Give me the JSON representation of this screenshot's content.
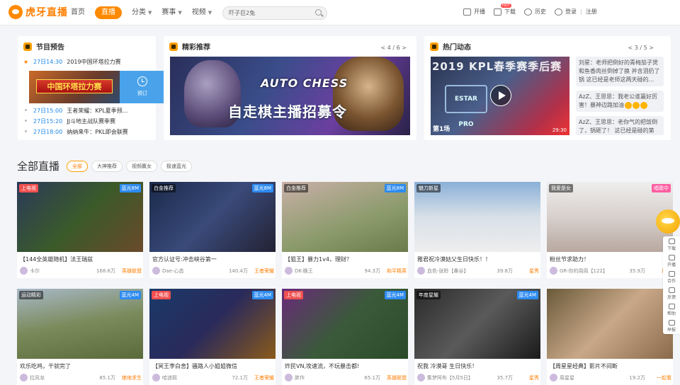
{
  "brand": {
    "name": "虎牙直播"
  },
  "nav": {
    "items": [
      {
        "label": "首页"
      },
      {
        "label": "直播"
      },
      {
        "label": "分类"
      },
      {
        "label": "赛事"
      },
      {
        "label": "视频"
      }
    ]
  },
  "search": {
    "value": "吓子巨2兔"
  },
  "tools": {
    "live": "开播",
    "download": "下载",
    "download_badge": "HOT",
    "history": "历史",
    "login": "登录",
    "sep": "|",
    "register": "注册"
  },
  "schedule": {
    "title": "节目预告",
    "featured_banner": "中国环塔拉力赛",
    "book": "预订",
    "rows": [
      {
        "time": "27日14:30",
        "title": "2019中国环塔拉力赛"
      },
      {
        "time": "27日15:00",
        "title": "王者荣耀：KPL夏季预..."
      },
      {
        "time": "27日15:20",
        "title": "JJ斗地主战队赛季赛"
      },
      {
        "time": "27日18:00",
        "title": "纳纳来牛：PKL即会联赛"
      }
    ]
  },
  "featured": {
    "title": "精彩推荐",
    "pager": "< 4 / 6 >",
    "logo": "AUTO CHESS",
    "headline": "自走棋主播招募令"
  },
  "hot": {
    "title": "热门动态",
    "pager": "< 3 / 5 >",
    "video_title": "2019 KPL春季赛季后赛",
    "team": "ESTAR PRO",
    "round": "第1场",
    "duration": "29:30",
    "comments": [
      {
        "text": "刘星：老师把倒好的青梅茄子煲和鱼香肉丝倒掉了换 并含泪扔了锅 这已经是老师这两天碰的..."
      },
      {
        "text": "AzZ、王思思：我老公谁赢好厉害！暴神边路加油"
      },
      {
        "text": "AzZ、王思思：老你气的把饭倒了，锅砸了！ 这已经是碰的第"
      }
    ]
  },
  "section": {
    "title": "全部直播",
    "chips": [
      "全部",
      "大神推荐",
      "视频赢女",
      "极速蓝光"
    ]
  },
  "cards": [
    {
      "tag": "上电视",
      "quality": "蓝光8M",
      "title": "【144全英雄随机】法王瑞兹",
      "user": "卡尔",
      "views": "168.6万",
      "cat": "英雄联盟"
    },
    {
      "tag": "白金推荐",
      "quality": "蓝光8M",
      "title": "官方认证号:冲击峡谷第一",
      "user": "Dae-心态",
      "views": "140.4万",
      "cat": "王者荣耀"
    },
    {
      "tag": "白金推荐",
      "quality": "蓝光8M",
      "title": "【狙王】暴力1v4，理财？",
      "user": "DK-晚王",
      "views": "94.3万",
      "cat": "和平精英"
    },
    {
      "tag": "魅力新星",
      "quality": "",
      "title": "雅君祝冷漠姑父生日快乐！！",
      "user": "血色-张聆【桑谷】",
      "views": "39.8万",
      "cat": "星秀"
    },
    {
      "tag": "我爱是女",
      "quality": "唱歌中",
      "title": "粉丝节求助力！",
      "user": "GR-你的周周【122】",
      "views": "35.9万",
      "cat": "星秀"
    },
    {
      "tag": "运动精彩",
      "quality": "蓝光4M",
      "title": "欢乐吃鸡，干就完了",
      "user": "拉风龙",
      "views": "85.1万",
      "cat": "绝地求生"
    },
    {
      "tag": "上电视",
      "quality": "蓝光4M",
      "title": "【冥王李白舍】骚路人小姐姐微信",
      "user": "哈迷熙",
      "views": "72.1万",
      "cat": "王者荣耀"
    },
    {
      "tag": "上电视",
      "quality": "蓝光4M",
      "title": "炸民VN,攻速流，不玩暴击都!",
      "user": "胖作",
      "views": "65.1万",
      "cat": "英雄联盟"
    },
    {
      "tag": "年度星耀",
      "quality": "蓝光4M",
      "title": "祝我 冷漠哥 生日快乐！",
      "user": "集梦阿布【5月5日】",
      "views": "35.7万",
      "cat": "星秀"
    },
    {
      "tag": "",
      "quality": "",
      "title": "【周星星经典】影片不间断",
      "user": "周星星",
      "views": "19.2万",
      "cat": "一起看"
    }
  ],
  "sidebar": {
    "items": [
      "下载",
      "开播",
      "合作",
      "反馈",
      "帮助",
      "举报"
    ]
  }
}
